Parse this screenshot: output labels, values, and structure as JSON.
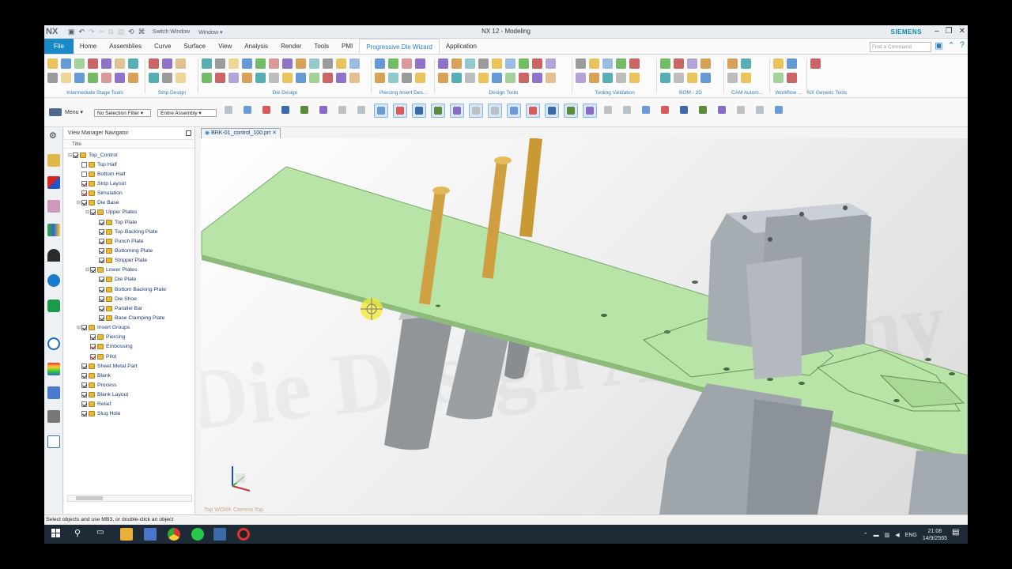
{
  "window": {
    "logo": "NX",
    "switch_window": "Switch Window",
    "window_menu": "Window ▾",
    "title": "NX 12 - Modeling",
    "brand": "SIEMENS"
  },
  "tabs": [
    "File",
    "Home",
    "Assemblies",
    "Curve",
    "Surface",
    "View",
    "Analysis",
    "Render",
    "Tools",
    "PMI",
    "Progressive Die Wizard",
    "Application"
  ],
  "active_tab": "Progressive Die Wizard",
  "find_command_placeholder": "Find a Command",
  "ribbon_groups": [
    {
      "label": "Intermediate Stage Tools"
    },
    {
      "label": "Strip Design"
    },
    {
      "label": "Die Design"
    },
    {
      "label": "Piercing Insert Des..."
    },
    {
      "label": "Design Tools"
    },
    {
      "label": "Tooling Validation"
    },
    {
      "label": "BOM - 2D"
    },
    {
      "label": "CAM Autom..."
    },
    {
      "label": "Workflow ..."
    },
    {
      "label": "NX Generic Tools"
    }
  ],
  "toolbar": {
    "menu": "Menu ▾",
    "selection_filter": "No Selection Filter",
    "scope": "Entire Assembly"
  },
  "navigator": {
    "title": "View Manager Navigator",
    "column": "Title",
    "items": [
      {
        "label": "Top_Control",
        "level": 0,
        "expand": "⊟",
        "checked": true,
        "red": false
      },
      {
        "label": "Top Half",
        "level": 1,
        "expand": "",
        "checked": false,
        "red": false
      },
      {
        "label": "Bottom Half",
        "level": 1,
        "expand": "",
        "checked": false,
        "red": false
      },
      {
        "label": "Strip Layout",
        "level": 1,
        "expand": "",
        "checked": true,
        "red": true
      },
      {
        "label": "Simulation",
        "level": 1,
        "expand": "",
        "checked": true,
        "red": true
      },
      {
        "label": "Die Base",
        "level": 1,
        "expand": "⊟",
        "checked": true,
        "red": false
      },
      {
        "label": "Upper Plates",
        "level": 2,
        "expand": "⊟",
        "checked": true,
        "red": false
      },
      {
        "label": "Top Plate",
        "level": 3,
        "expand": "",
        "checked": true,
        "red": false
      },
      {
        "label": "Top Backing Plate",
        "level": 3,
        "expand": "",
        "checked": true,
        "red": false
      },
      {
        "label": "Punch Plate",
        "level": 3,
        "expand": "",
        "checked": true,
        "red": false
      },
      {
        "label": "Bottoming Plate",
        "level": 3,
        "expand": "",
        "checked": true,
        "red": false
      },
      {
        "label": "Stripper Plate",
        "level": 3,
        "expand": "",
        "checked": true,
        "red": false
      },
      {
        "label": "Lower Plates",
        "level": 2,
        "expand": "⊟",
        "checked": true,
        "red": false
      },
      {
        "label": "Die Plate",
        "level": 3,
        "expand": "",
        "checked": true,
        "red": false
      },
      {
        "label": "Bottom Backing Plate",
        "level": 3,
        "expand": "",
        "checked": true,
        "red": false
      },
      {
        "label": "Die Shoe",
        "level": 3,
        "expand": "",
        "checked": true,
        "red": false
      },
      {
        "label": "Parallel Bar",
        "level": 3,
        "expand": "",
        "checked": true,
        "red": false
      },
      {
        "label": "Base Clamping Plate",
        "level": 3,
        "expand": "",
        "checked": true,
        "red": false
      },
      {
        "label": "Insert Groups",
        "level": 1,
        "expand": "⊟",
        "checked": true,
        "red": false
      },
      {
        "label": "Piercing",
        "level": 2,
        "expand": "",
        "checked": true,
        "red": false
      },
      {
        "label": "Embossing",
        "level": 2,
        "expand": "",
        "checked": true,
        "red": true
      },
      {
        "label": "Pilot",
        "level": 2,
        "expand": "",
        "checked": true,
        "red": true
      },
      {
        "label": "Sheet Metal Part",
        "level": 1,
        "expand": "",
        "checked": true,
        "red": false
      },
      {
        "label": "Blank",
        "level": 1,
        "expand": "",
        "checked": true,
        "red": false
      },
      {
        "label": "Process",
        "level": 1,
        "expand": "",
        "checked": true,
        "red": false
      },
      {
        "label": "Blank Layout",
        "level": 1,
        "expand": "",
        "checked": true,
        "red": false
      },
      {
        "label": "Relief",
        "level": 1,
        "expand": "",
        "checked": true,
        "red": false
      },
      {
        "label": "Slug Hole",
        "level": 1,
        "expand": "",
        "checked": true,
        "red": false
      }
    ]
  },
  "document_tab": "BRK-01_control_100.prt",
  "viewport": {
    "footer": "Top WORK Camera Top",
    "watermark": "Die Design Academy"
  },
  "status_text": "Select objects and use MB3, or double-click an object",
  "taskbar": {
    "language": "ENG",
    "time": "21:08",
    "date": "14/9/2565"
  },
  "colors": {
    "accent": "#1a8ac6",
    "strip_green": "#b6e3a6",
    "punch_orange": "#d4a33d",
    "steel_gray": "#a9b0b6"
  }
}
